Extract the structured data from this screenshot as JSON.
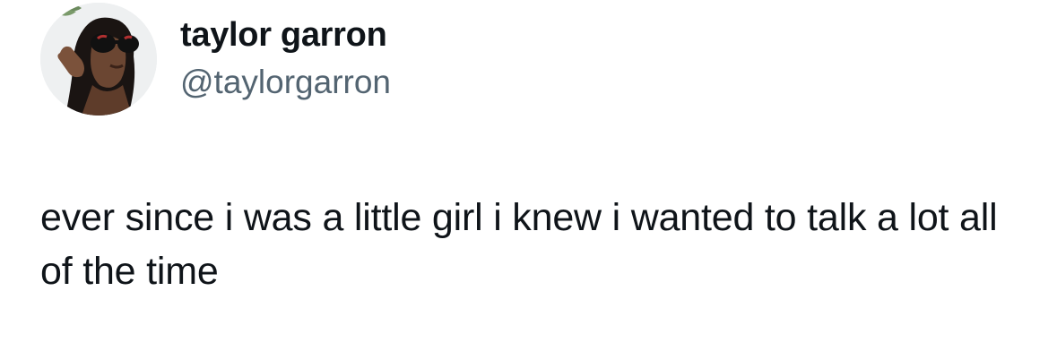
{
  "tweet": {
    "author": {
      "display_name": "taylor garron",
      "handle": "@taylorgarron",
      "avatar_icon": "profile-photo"
    },
    "text": "ever since i was a little girl i knew i wanted to talk a lot all of the time"
  },
  "colors": {
    "text_primary": "#0f1419",
    "text_secondary": "#536471",
    "background": "#ffffff"
  }
}
